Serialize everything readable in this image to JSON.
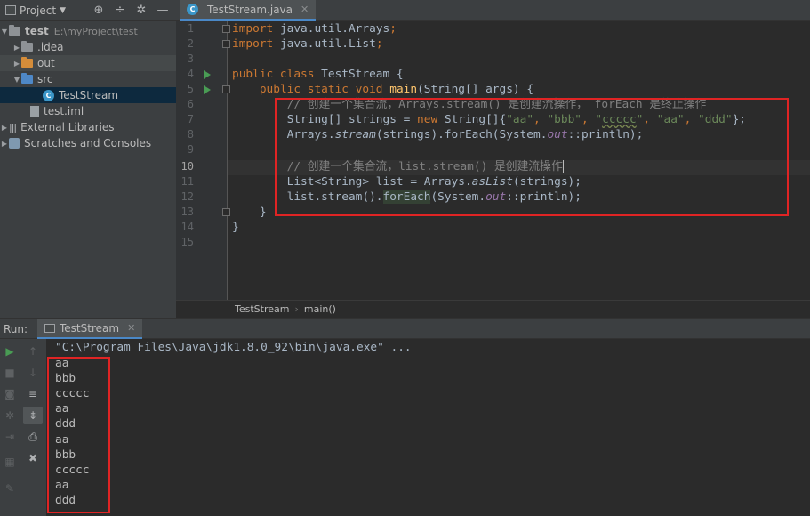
{
  "project_panel": {
    "title": "Project",
    "tree": [
      {
        "label": "test",
        "path": "E:\\myProject\\test"
      },
      {
        "label": ".idea"
      },
      {
        "label": "out"
      },
      {
        "label": "src"
      },
      {
        "label": "TestStream"
      },
      {
        "label": "test.iml"
      },
      {
        "label": "External Libraries"
      },
      {
        "label": "Scratches and Consoles"
      }
    ]
  },
  "editor": {
    "tab_label": "TestStream.java",
    "line_numbers": [
      "1",
      "2",
      "3",
      "4",
      "5",
      "6",
      "7",
      "8",
      "9",
      "10",
      "11",
      "12",
      "13",
      "14",
      "15"
    ],
    "current_line": "10",
    "breadcrumb": [
      "TestStream",
      "main()"
    ]
  },
  "code": {
    "l1": {
      "kw": "import",
      "rest": " java.util.Arrays",
      "semi": ";"
    },
    "l2": {
      "kw": "import",
      "rest": " java.util.List",
      "semi": ";"
    },
    "l4": {
      "kw": "public class",
      "rest": " TestStream {"
    },
    "l5": {
      "kw": "public static void",
      "fn": "main",
      "rest": "(String[] args) {"
    },
    "l6": {
      "comment": "// 创建一个集合流，Arrays.stream() 是创建流操作， forEach 是终止操作"
    },
    "l7": {
      "a": "String[] strings = ",
      "kw": "new",
      "b": " String[]{",
      "s1": "\"aa\"",
      "s2": "\"bbb\"",
      "s3q": "\"",
      "s3": "ccccc",
      "s3e": "\"",
      "s4": "\"aa\"",
      "s5": "\"ddd\"",
      "end": "};",
      "sep": ", "
    },
    "l8": {
      "a": "Arrays.",
      "it": "stream",
      "b": "(strings).forEach(System.",
      "fld": "out",
      "c": "::println);"
    },
    "l10": {
      "comment": "// 创建一个集合流，list.stream() 是创建流操作"
    },
    "l11": {
      "a": "List<String> list = Arrays.",
      "it": "asList",
      "b": "(strings);"
    },
    "l12": {
      "a": "list.stream().",
      "hl": "forEach",
      "b": "(System.",
      "fld": "out",
      "c": "::println);"
    },
    "l13": {
      "text": "}"
    },
    "l14": {
      "text": "}"
    }
  },
  "run_panel": {
    "label": "Run:",
    "tab_label": "TestStream",
    "command": "\"C:\\Program Files\\Java\\jdk1.8.0_92\\bin\\java.exe\" ...",
    "output": [
      "aa",
      "bbb",
      "ccccc",
      "aa",
      "ddd",
      "aa",
      "bbb",
      "ccccc",
      "aa",
      "ddd"
    ]
  },
  "icons": [
    "project-view-icon",
    "target-icon",
    "collapse-icon",
    "settings-icon",
    "hide-icon",
    "java-file-icon",
    "run-icon",
    "stop-icon",
    "camera-icon",
    "settings-icon",
    "exit-icon",
    "layout-icon",
    "pin-icon",
    "up-icon",
    "down-icon",
    "soft-wrap-icon",
    "scroll-end-icon",
    "print-icon",
    "trash-icon"
  ],
  "colors": {
    "keyword": "#cc7832",
    "string": "#6a8759",
    "comment": "#808080",
    "function": "#ffc66d",
    "field": "#9876aa",
    "annotation_box": "#e02424",
    "run_green": "#499c54"
  }
}
